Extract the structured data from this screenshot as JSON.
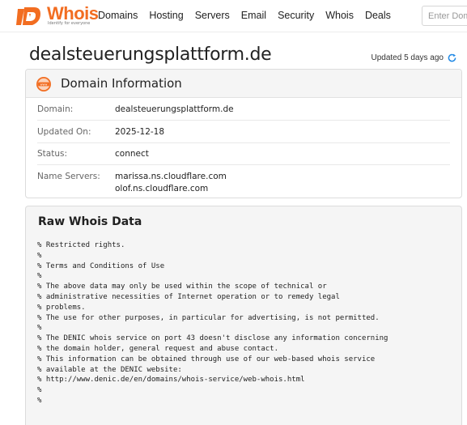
{
  "header": {
    "logo_text": "Whois",
    "logo_tagline": "Identify for everyone",
    "nav": [
      "Domains",
      "Hosting",
      "Servers",
      "Email",
      "Security",
      "Whois",
      "Deals"
    ],
    "search_placeholder": "Enter Domain or IP"
  },
  "page": {
    "title": "dealsteuerungsplattform.de",
    "updated": "Updated 5 days ago"
  },
  "domain_info": {
    "title": "Domain Information",
    "rows": [
      {
        "label": "Domain:",
        "value": "dealsteuerungsplattform.de"
      },
      {
        "label": "Updated On:",
        "value": "2025-12-18"
      },
      {
        "label": "Status:",
        "value": "connect"
      },
      {
        "label": "Name Servers:",
        "values": [
          "marissa.ns.cloudflare.com",
          "olof.ns.cloudflare.com"
        ]
      }
    ]
  },
  "raw_whois": {
    "title": "Raw Whois Data",
    "lines": [
      "% Restricted rights.",
      "%",
      "% Terms and Conditions of Use",
      "%",
      "% The above data may only be used within the scope of technical or",
      "% administrative necessities of Internet operation or to remedy legal",
      "% problems.",
      "% The use for other purposes, in particular for advertising, is not permitted.",
      "%",
      "% The DENIC whois service on port 43 doesn't disclose any information concerning",
      "% the domain holder, general request and abuse contact.",
      "% This information can be obtained through use of our web-based whois service",
      "% available at the DENIC website:",
      "% http://www.denic.de/en/domains/whois-service/web-whois.html",
      "%",
      "%"
    ]
  },
  "colors": {
    "brand": "#f26d21",
    "refresh": "#1e88e5"
  },
  "icons": {
    "logo": "whois-logo-icon",
    "refresh": "refresh-icon",
    "domain_info": "www-globe-icon"
  }
}
